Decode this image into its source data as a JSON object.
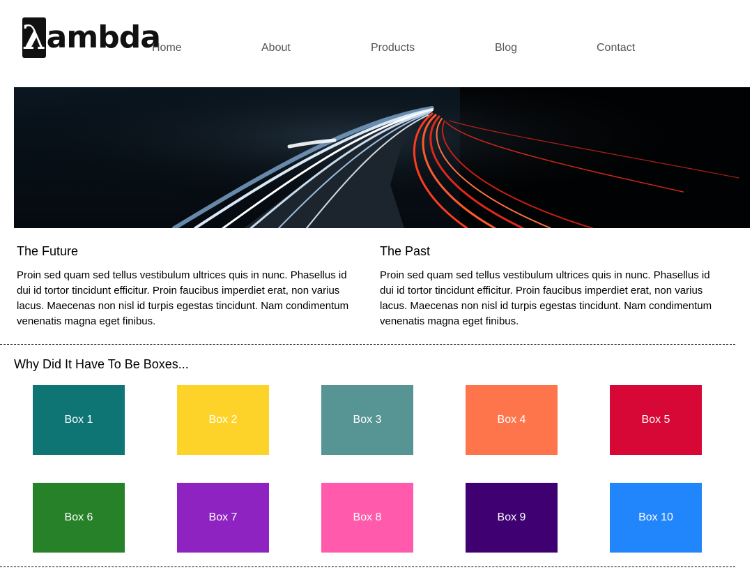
{
  "header": {
    "logo_symbol": "λ",
    "logo_text": "ambda",
    "nav": [
      "Home",
      "About",
      "Products",
      "Blog",
      "Contact"
    ]
  },
  "articles": [
    {
      "title": "The Future",
      "body": "Proin sed quam sed tellus vestibulum ultrices quis in nunc. Phasellus id dui id tortor tincidunt efficitur. Proin faucibus imperdiet erat, non varius lacus. Maecenas non nisl id turpis egestas tincidunt. Nam condimentum venenatis magna eget finibus."
    },
    {
      "title": "The Past",
      "body": "Proin sed quam sed tellus vestibulum ultrices quis in nunc. Phasellus id dui id tortor tincidunt efficitur. Proin faucibus imperdiet erat, non varius lacus. Maecenas non nisl id turpis egestas tincidunt. Nam condimentum venenatis magna eget finibus."
    }
  ],
  "boxes_section": {
    "title": "Why Did It Have To Be Boxes...",
    "boxes": [
      {
        "label": "Box 1",
        "color": "#0f7574"
      },
      {
        "label": "Box 2",
        "color": "#fed329"
      },
      {
        "label": "Box 3",
        "color": "#579595"
      },
      {
        "label": "Box 4",
        "color": "#ff754b"
      },
      {
        "label": "Box 5",
        "color": "#d80836"
      },
      {
        "label": "Box 6",
        "color": "#268128"
      },
      {
        "label": "Box 7",
        "color": "#8e23c1"
      },
      {
        "label": "Box 8",
        "color": "#ff5aab"
      },
      {
        "label": "Box 9",
        "color": "#3f0071"
      },
      {
        "label": "Box 10",
        "color": "#2185fb"
      }
    ]
  }
}
